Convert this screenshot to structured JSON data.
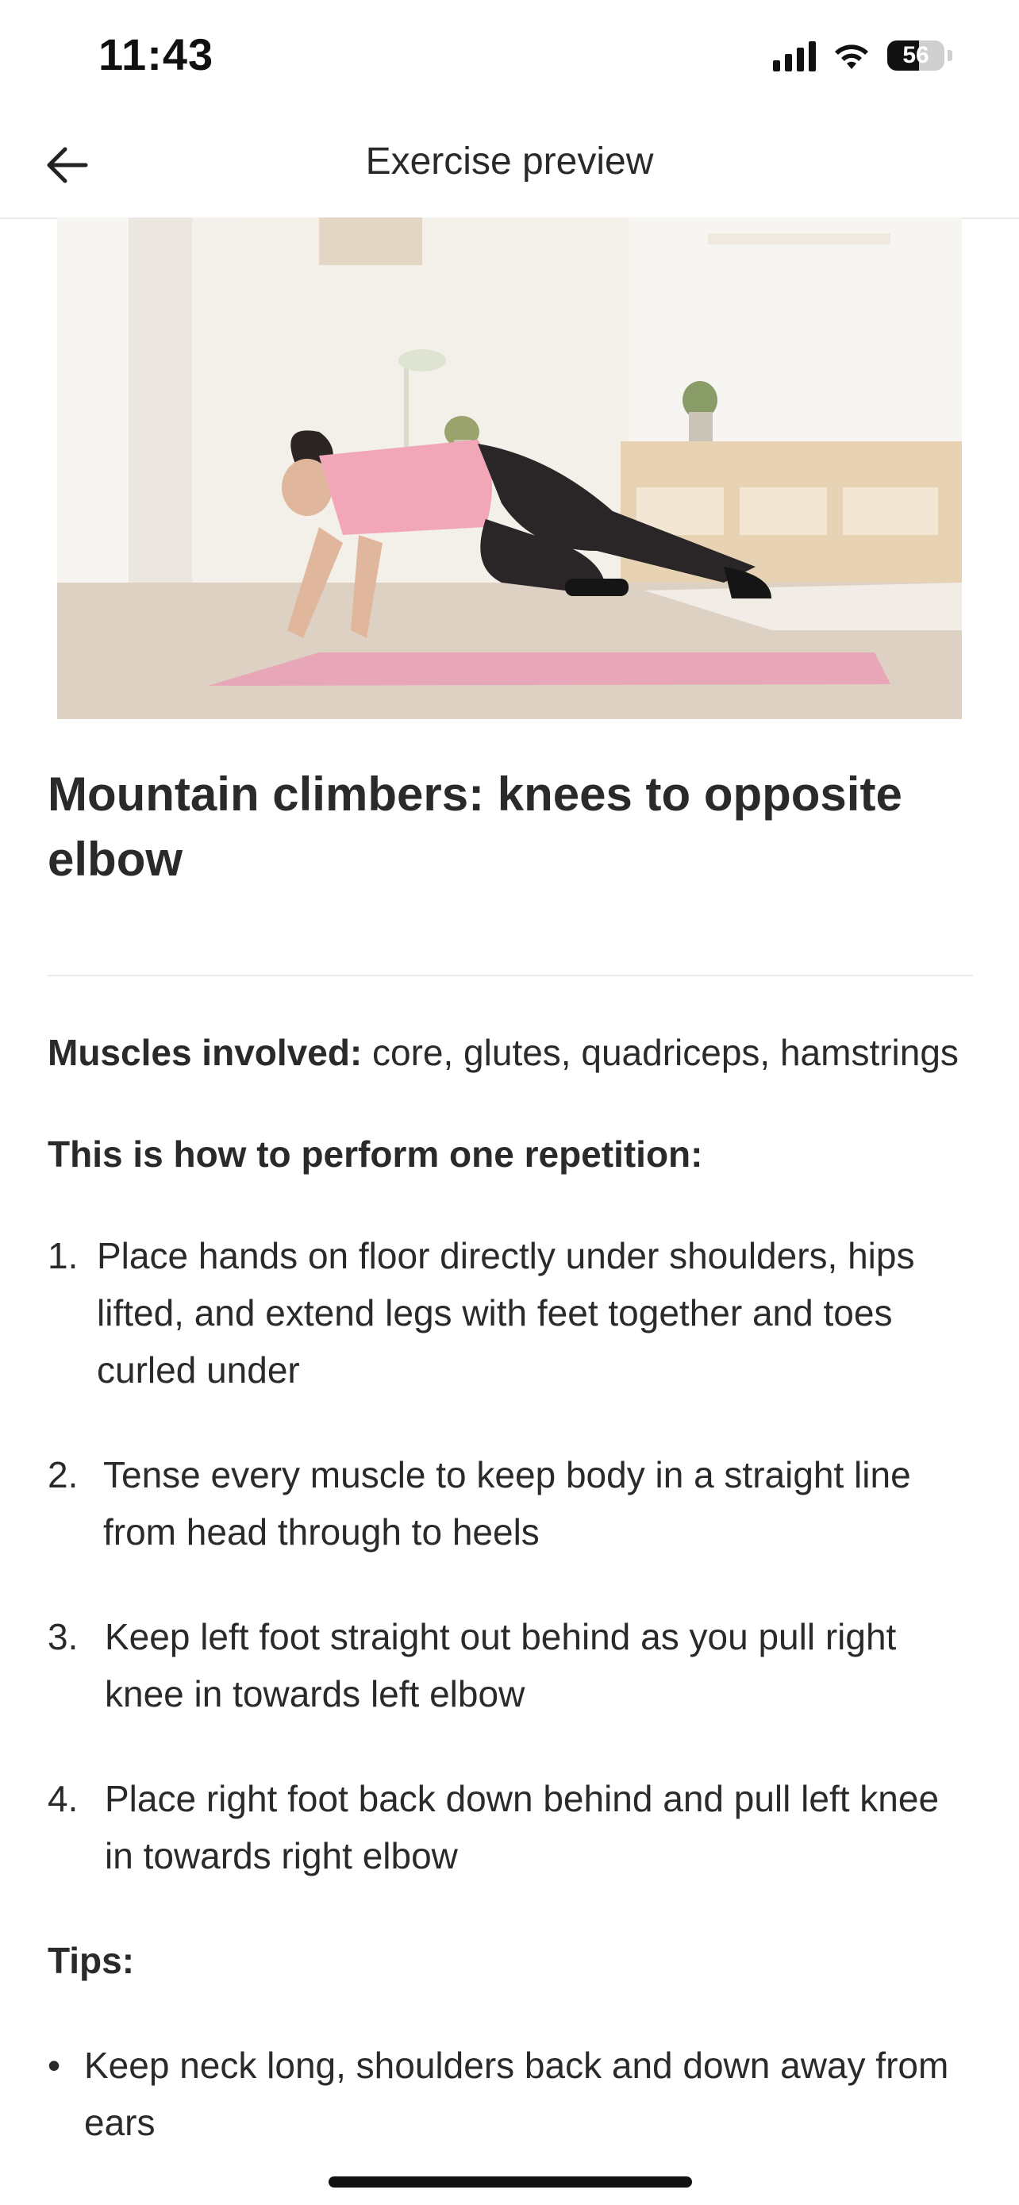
{
  "status_bar": {
    "time": "11:43",
    "battery": "56",
    "battery_level": 0.56
  },
  "nav": {
    "title": "Exercise preview",
    "back_icon": "arrow-left-icon"
  },
  "hero": {
    "alt": "exercise-demo-image"
  },
  "exercise": {
    "title": "Mountain climbers: knees to opposite elbow",
    "muscles_label": "Muscles involved:",
    "muscles_value": " core, glutes, quadriceps, hamstrings",
    "howto_label": "This is how to perform one repetition:",
    "steps": [
      {
        "num": "1.",
        "text": "Place hands on floor directly under shoulders, hips lifted, and extend legs with feet together and toes curled under"
      },
      {
        "num": "2.",
        "text": "Tense every muscle to keep body in a straight line from head through to heels"
      },
      {
        "num": "3.",
        "text": "Keep left foot straight out behind as you pull right knee in towards left elbow"
      },
      {
        "num": "4.",
        "text": "Place right foot back down behind and pull left knee in towards right elbow"
      }
    ],
    "tips_label": "Tips:",
    "tips": [
      {
        "bullet": "•",
        "text": "Keep neck long, shoulders back and down away from ears"
      }
    ]
  }
}
